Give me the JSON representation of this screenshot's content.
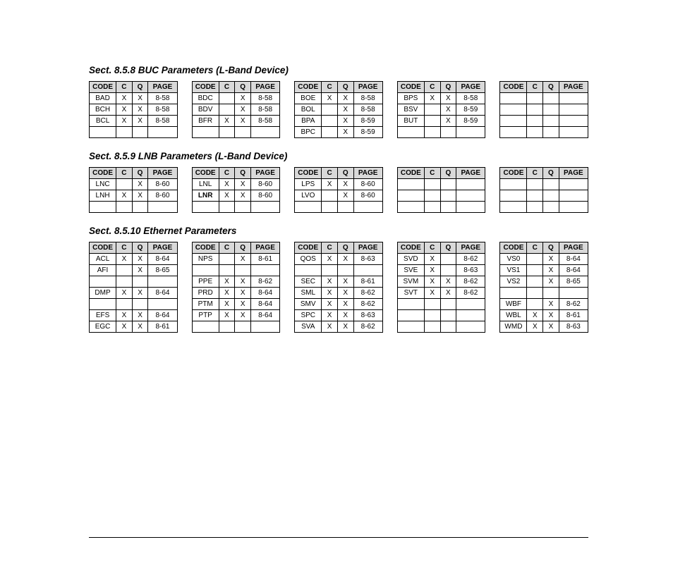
{
  "headers": {
    "code": "CODE",
    "c": "C",
    "q": "Q",
    "page": "PAGE"
  },
  "sections": [
    {
      "title": "Sect. 8.5.8 BUC Parameters (L-Band Device)",
      "tables": [
        {
          "rows": [
            {
              "code": "BAD",
              "c": "X",
              "q": "X",
              "page": "8-58"
            },
            {
              "code": "BCH",
              "c": "X",
              "q": "X",
              "page": "8-58"
            },
            {
              "code": "BCL",
              "c": "X",
              "q": "X",
              "page": "8-58"
            },
            {
              "code": "",
              "c": "",
              "q": "",
              "page": ""
            }
          ]
        },
        {
          "rows": [
            {
              "code": "BDC",
              "c": "",
              "q": "X",
              "page": "8-58"
            },
            {
              "code": "BDV",
              "c": "",
              "q": "X",
              "page": "8-58"
            },
            {
              "code": "BFR",
              "c": "X",
              "q": "X",
              "page": "8-58"
            },
            {
              "code": "",
              "c": "",
              "q": "",
              "page": ""
            }
          ]
        },
        {
          "rows": [
            {
              "code": "BOE",
              "c": "X",
              "q": "X",
              "page": "8-58"
            },
            {
              "code": "BOL",
              "c": "",
              "q": "X",
              "page": "8-58"
            },
            {
              "code": "BPA",
              "c": "",
              "q": "X",
              "page": "8-59"
            },
            {
              "code": "BPC",
              "c": "",
              "q": "X",
              "page": "8-59"
            }
          ]
        },
        {
          "rows": [
            {
              "code": "BPS",
              "c": "X",
              "q": "X",
              "page": "8-58"
            },
            {
              "code": "BSV",
              "c": "",
              "q": "X",
              "page": "8-59"
            },
            {
              "code": "BUT",
              "c": "",
              "q": "X",
              "page": "8-59"
            },
            {
              "code": "",
              "c": "",
              "q": "",
              "page": ""
            }
          ]
        },
        {
          "rows": [
            {
              "code": "",
              "c": "",
              "q": "",
              "page": ""
            },
            {
              "code": "",
              "c": "",
              "q": "",
              "page": ""
            },
            {
              "code": "",
              "c": "",
              "q": "",
              "page": ""
            },
            {
              "code": "",
              "c": "",
              "q": "",
              "page": ""
            }
          ]
        }
      ]
    },
    {
      "title": "Sect. 8.5.9 LNB Parameters (L-Band Device)",
      "tables": [
        {
          "rows": [
            {
              "code": "LNC",
              "c": "",
              "q": "X",
              "page": "8-60"
            },
            {
              "code": "LNH",
              "c": "X",
              "q": "X",
              "page": "8-60"
            },
            {
              "code": "",
              "c": "",
              "q": "",
              "page": ""
            }
          ]
        },
        {
          "rows": [
            {
              "code": "LNL",
              "c": "X",
              "q": "X",
              "page": "8-60"
            },
            {
              "code": "LNR",
              "bold": true,
              "c": "X",
              "q": "X",
              "page": "8-60"
            },
            {
              "code": "",
              "c": "",
              "q": "",
              "page": ""
            }
          ]
        },
        {
          "rows": [
            {
              "code": "LPS",
              "c": "X",
              "q": "X",
              "page": "8-60"
            },
            {
              "code": "LVO",
              "c": "",
              "q": "X",
              "page": "8-60"
            },
            {
              "code": "",
              "c": "",
              "q": "",
              "page": ""
            }
          ]
        },
        {
          "rows": [
            {
              "code": "",
              "c": "",
              "q": "",
              "page": ""
            },
            {
              "code": "",
              "c": "",
              "q": "",
              "page": ""
            },
            {
              "code": "",
              "c": "",
              "q": "",
              "page": ""
            }
          ]
        },
        {
          "rows": [
            {
              "code": "",
              "c": "",
              "q": "",
              "page": ""
            },
            {
              "code": "",
              "c": "",
              "q": "",
              "page": ""
            },
            {
              "code": "",
              "c": "",
              "q": "",
              "page": ""
            }
          ]
        }
      ]
    },
    {
      "title": "Sect. 8.5.10 Ethernet Parameters",
      "tables": [
        {
          "rows": [
            {
              "code": "ACL",
              "c": "X",
              "q": "X",
              "page": "8-64"
            },
            {
              "code": "AFI",
              "c": "",
              "q": "X",
              "page": "8-65"
            },
            {
              "code": "",
              "c": "",
              "q": "",
              "page": ""
            },
            {
              "code": "DMP",
              "c": "X",
              "q": "X",
              "page": "8-64"
            },
            {
              "code": "",
              "c": "",
              "q": "",
              "page": ""
            },
            {
              "code": "EFS",
              "c": "X",
              "q": "X",
              "page": "8-64"
            },
            {
              "code": "EGC",
              "c": "X",
              "q": "X",
              "page": "8-61"
            }
          ]
        },
        {
          "rows": [
            {
              "code": "NPS",
              "c": "",
              "q": "X",
              "page": "8-61"
            },
            {
              "code": "",
              "c": "",
              "q": "",
              "page": ""
            },
            {
              "code": "PPE",
              "c": "X",
              "q": "X",
              "page": "8-62"
            },
            {
              "code": "PRD",
              "c": "X",
              "q": "X",
              "page": "8-64"
            },
            {
              "code": "PTM",
              "c": "X",
              "q": "X",
              "page": "8-64"
            },
            {
              "code": "PTP",
              "c": "X",
              "q": "X",
              "page": "8-64"
            },
            {
              "code": "",
              "c": "",
              "q": "",
              "page": ""
            }
          ]
        },
        {
          "rows": [
            {
              "code": "QOS",
              "c": "X",
              "q": "X",
              "page": "8-63"
            },
            {
              "code": "",
              "c": "",
              "q": "",
              "page": ""
            },
            {
              "code": "SEC",
              "c": "X",
              "q": "X",
              "page": "8-61"
            },
            {
              "code": "SML",
              "c": "X",
              "q": "X",
              "page": "8-62"
            },
            {
              "code": "SMV",
              "c": "X",
              "q": "X",
              "page": "8-62"
            },
            {
              "code": "SPC",
              "c": "X",
              "q": "X",
              "page": "8-63"
            },
            {
              "code": "SVA",
              "c": "X",
              "q": "X",
              "page": "8-62"
            }
          ]
        },
        {
          "rows": [
            {
              "code": "SVD",
              "c": "X",
              "q": "",
              "page": "8-62"
            },
            {
              "code": "SVE",
              "c": "X",
              "q": "",
              "page": "8-63"
            },
            {
              "code": "SVM",
              "c": "X",
              "q": "X",
              "page": "8-62"
            },
            {
              "code": "SVT",
              "c": "X",
              "q": "X",
              "page": "8-62"
            },
            {
              "code": "",
              "c": "",
              "q": "",
              "page": ""
            },
            {
              "code": "",
              "c": "",
              "q": "",
              "page": ""
            },
            {
              "code": "",
              "c": "",
              "q": "",
              "page": ""
            }
          ]
        },
        {
          "rows": [
            {
              "code": "VS0",
              "c": "",
              "q": "X",
              "page": "8-64"
            },
            {
              "code": "VS1",
              "c": "",
              "q": "X",
              "page": "8-64"
            },
            {
              "code": "VS2",
              "c": "",
              "q": "X",
              "page": "8-65"
            },
            {
              "code": "",
              "c": "",
              "q": "",
              "page": ""
            },
            {
              "code": "WBF",
              "c": "",
              "q": "X",
              "page": "8-62"
            },
            {
              "code": "WBL",
              "c": "X",
              "q": "X",
              "page": "8-61"
            },
            {
              "code": "WMD",
              "c": "X",
              "q": "X",
              "page": "8-63"
            }
          ]
        }
      ]
    }
  ]
}
